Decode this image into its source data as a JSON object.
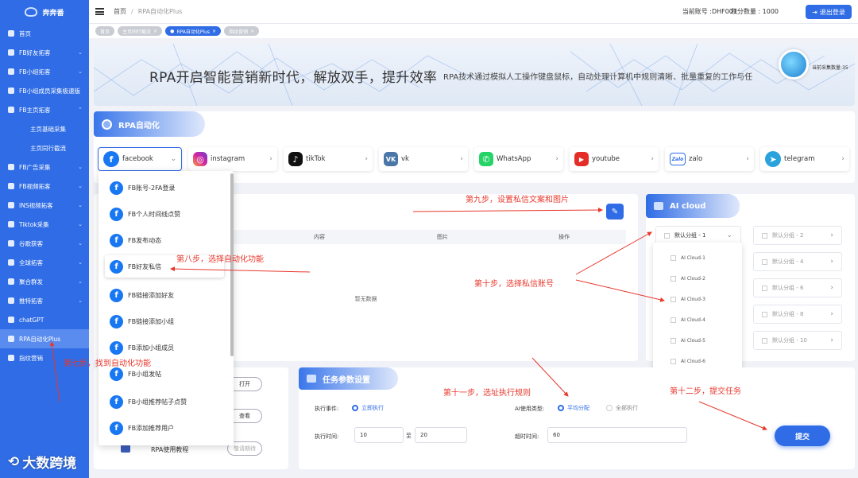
{
  "sidebar": {
    "brand": "奔奔番",
    "items": [
      {
        "label": "首页"
      },
      {
        "label": "FB好友拓客"
      },
      {
        "label": "FB小组拓客"
      },
      {
        "label": "FB小组成员采集极速版"
      },
      {
        "label": "FB主页拓客"
      },
      {
        "label": "主页基础采集"
      },
      {
        "label": "主页同行截流"
      },
      {
        "label": "FB广告采集"
      },
      {
        "label": "FB视频拓客"
      },
      {
        "label": "INS视频拓客"
      },
      {
        "label": "Tiktok采集"
      },
      {
        "label": "谷歌获客"
      },
      {
        "label": "全球拓客"
      },
      {
        "label": "聚合群发"
      },
      {
        "label": "推特拓客"
      },
      {
        "label": "chatGPT"
      },
      {
        "label": "RPA自动化Plus"
      },
      {
        "label": "指纹营销"
      }
    ]
  },
  "topbar": {
    "home": "首页",
    "current": "RPA自动化Plus",
    "account": "当前账号 :DHF001",
    "points": "积分数量 : 1000",
    "logout": "退出登录"
  },
  "tags": [
    "首页",
    "主页同行截流",
    "RPA自动化Plus",
    "指纹营销"
  ],
  "banner": {
    "title": "RPA开启智能营销新时代，解放双手，提升效率",
    "subtitle": "RPA技术通过模拟人工操作键盘鼠标，自动处理计算机中规则清晰、批量重复的工作与任",
    "collect": "当前采集数量:35"
  },
  "rpa": {
    "title": "RPA自动化",
    "platforms": [
      "facebook",
      "instagram",
      "tikTok",
      "vk",
      "WhatsApp",
      "youtube",
      "zalo",
      "telegram"
    ]
  },
  "fb_menu": [
    "FB账号-2FA登录",
    "FB个人时间线点赞",
    "FB发布动态",
    "FB好友私信",
    "FB链接添加好友",
    "FB链接添加小组",
    "FB添加小组成员",
    "FB小组发帖",
    "FB小组推荐帖子点赞",
    "FB添加推荐用户"
  ],
  "content": {
    "col_content": "内容",
    "col_image": "图片",
    "col_action": "操作",
    "empty": "暂无数据"
  },
  "ai_cloud": {
    "title": "AI cloud",
    "groups": [
      "默认分组 - 1",
      "默认分组 - 2",
      "默认分组 - 4",
      "默认分组 - 6",
      "默认分组 - 8",
      "默认分组 - 10"
    ],
    "clouds": [
      "AI Cloud-1",
      "AI Cloud-2",
      "AI Cloud-3",
      "AI Cloud-4",
      "AI Cloud-5",
      "AI Cloud-6"
    ]
  },
  "left_bottom": {
    "open": "打开",
    "view": "查看",
    "tutorial": "RPA使用教程",
    "tutorial_btn": "敬请期待"
  },
  "task": {
    "title": "任务参数设置",
    "exec_event_label": "执行事件:",
    "exec_now": "立即执行",
    "ai_type_label": "AI使用类型:",
    "avg": "平均分配",
    "all": "全部执行",
    "exec_time_label": "执行时间:",
    "time_from": "10",
    "to": "至",
    "time_to": "20",
    "timeout_label": "超时时间:",
    "timeout": "60",
    "submit": "提交"
  },
  "annotations": {
    "step7": "第七步，找到自动化功能",
    "step8": "第八步，选择自动化功能",
    "step9": "第九步，设置私信文案和图片",
    "step10": "第十步，选择私信账号",
    "step11": "第十一步，选址执行规则",
    "step12": "第十二步，提交任务"
  },
  "watermark": "大数跨境",
  "colors": {
    "primary": "#2f6ce5",
    "annotation": "#e8382d"
  }
}
